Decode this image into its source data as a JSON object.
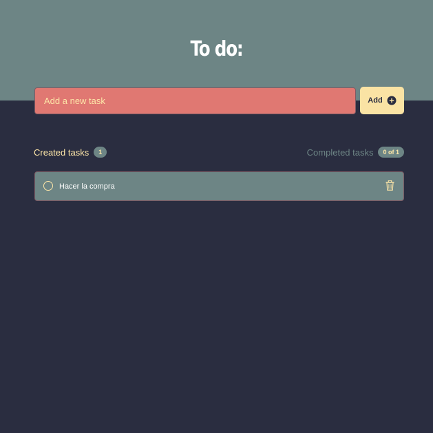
{
  "header": {
    "title": "To do:"
  },
  "new_task": {
    "placeholder": "Add a new task",
    "add_label": "Add"
  },
  "summary": {
    "created_label": "Created tasks",
    "created_count": "1",
    "completed_label": "Completed tasks",
    "completed_count": "0 of 1"
  },
  "tasks": [
    {
      "text": "Hacer la compra",
      "completed": false
    }
  ],
  "icons": {
    "add": "plus-circle-icon",
    "check": "circle-outline-icon",
    "delete": "trash-icon"
  },
  "colors": {
    "background": "#2a2d40",
    "header": "#6d8585",
    "input": "#e07872",
    "accent": "#fae3a4",
    "text_accent": "#fde6a8"
  }
}
